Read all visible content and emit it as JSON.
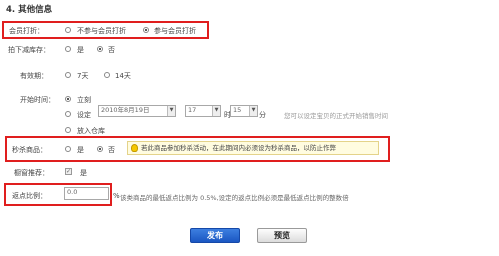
{
  "section": {
    "title": "4. 其他信息"
  },
  "member_discount": {
    "label": "会员打折：",
    "options": [
      "不参与会员打折",
      "参与会员打折"
    ],
    "selected": 1
  },
  "stock_reduction": {
    "label": "拍下减库存：",
    "options": [
      "是",
      "否"
    ],
    "selected": 1
  },
  "validity": {
    "label": "有效期：",
    "options": [
      "7天",
      "14天"
    ],
    "selected": 0
  },
  "start_time": {
    "label": "开始时间：",
    "options": [
      "立刻",
      "设定",
      "放入仓库"
    ],
    "selected": 0,
    "date_value": "2010年8月19日",
    "hour_value": "17",
    "hour_unit": "时",
    "minute_value": "15",
    "minute_unit": "分",
    "hint": "您可以设定宝贝的正式开始销售时间"
  },
  "flash_sale": {
    "label": "秒杀商品：",
    "options": [
      "是",
      "否"
    ],
    "selected": 1,
    "tip": "若此商品参加秒杀活动，在此期间内必须设为秒杀商品，以防止作弊"
  },
  "showcase": {
    "label": "橱窗推荐：",
    "checkbox_label": "是",
    "checked": true
  },
  "rebate": {
    "label": "返点比例：",
    "value": "0.0",
    "unit": "%",
    "hint": "该类商品的最低返点比例为 0.5%,设定的返点比例必须是最低返点比例的整数倍"
  },
  "actions": {
    "publish": "发布",
    "preview": "预览"
  },
  "colors": {
    "highlight_border": "#e01e1e",
    "primary_button": "#1a56c2",
    "tip_background": "#fffce0"
  }
}
